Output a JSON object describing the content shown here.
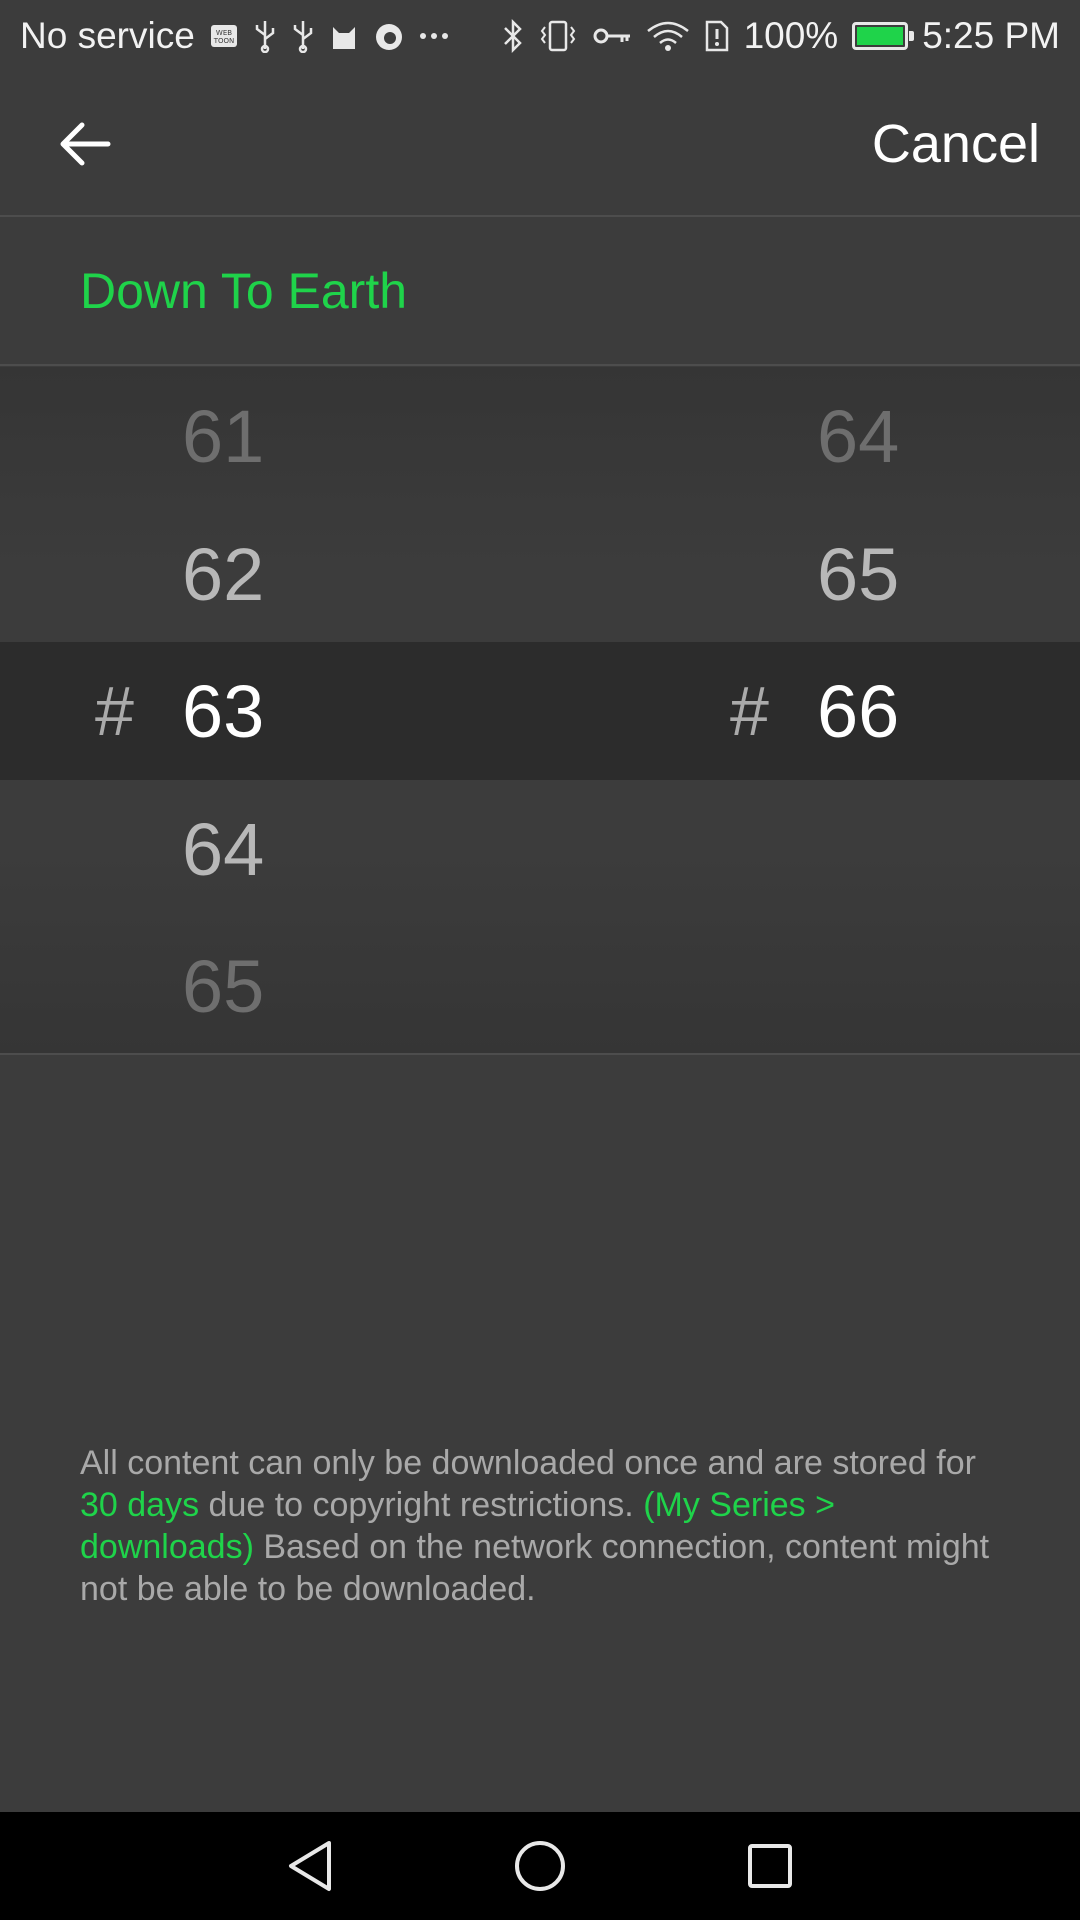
{
  "status_bar": {
    "carrier": "No service",
    "left_icons": [
      "webtoon-icon",
      "usb-icon",
      "usb-icon",
      "cat-icon",
      "firefox-icon",
      "more-dots-icon"
    ],
    "right_icons": [
      "bluetooth-icon",
      "vibrate-icon",
      "key-icon",
      "wifi-icon",
      "sim-alert-icon"
    ],
    "battery": "100%",
    "battery_level": 1.0,
    "time": "5:25 PM"
  },
  "app_bar": {
    "cancel_label": "Cancel"
  },
  "series": {
    "title": "Down To Earth"
  },
  "picker_left": {
    "rows": [
      "61",
      "62",
      "63",
      "64",
      "65"
    ],
    "selected": "63",
    "hash": "#"
  },
  "picker_right": {
    "rows": [
      "64",
      "65",
      "66"
    ],
    "selected": "66",
    "hash": "#"
  },
  "disclaimer": {
    "part1": "All content can only be downloaded once and are stored for ",
    "highlight1": "30 days",
    "part2": " due to copyright restrictions. ",
    "highlight2": "(My Series > downloads)",
    "part3": " Based on the network connection, content might not be able to be downloaded."
  },
  "colors": {
    "accent": "#1fd34a",
    "background": "#3c3c3c",
    "selected_band": "#2c2c2c"
  }
}
